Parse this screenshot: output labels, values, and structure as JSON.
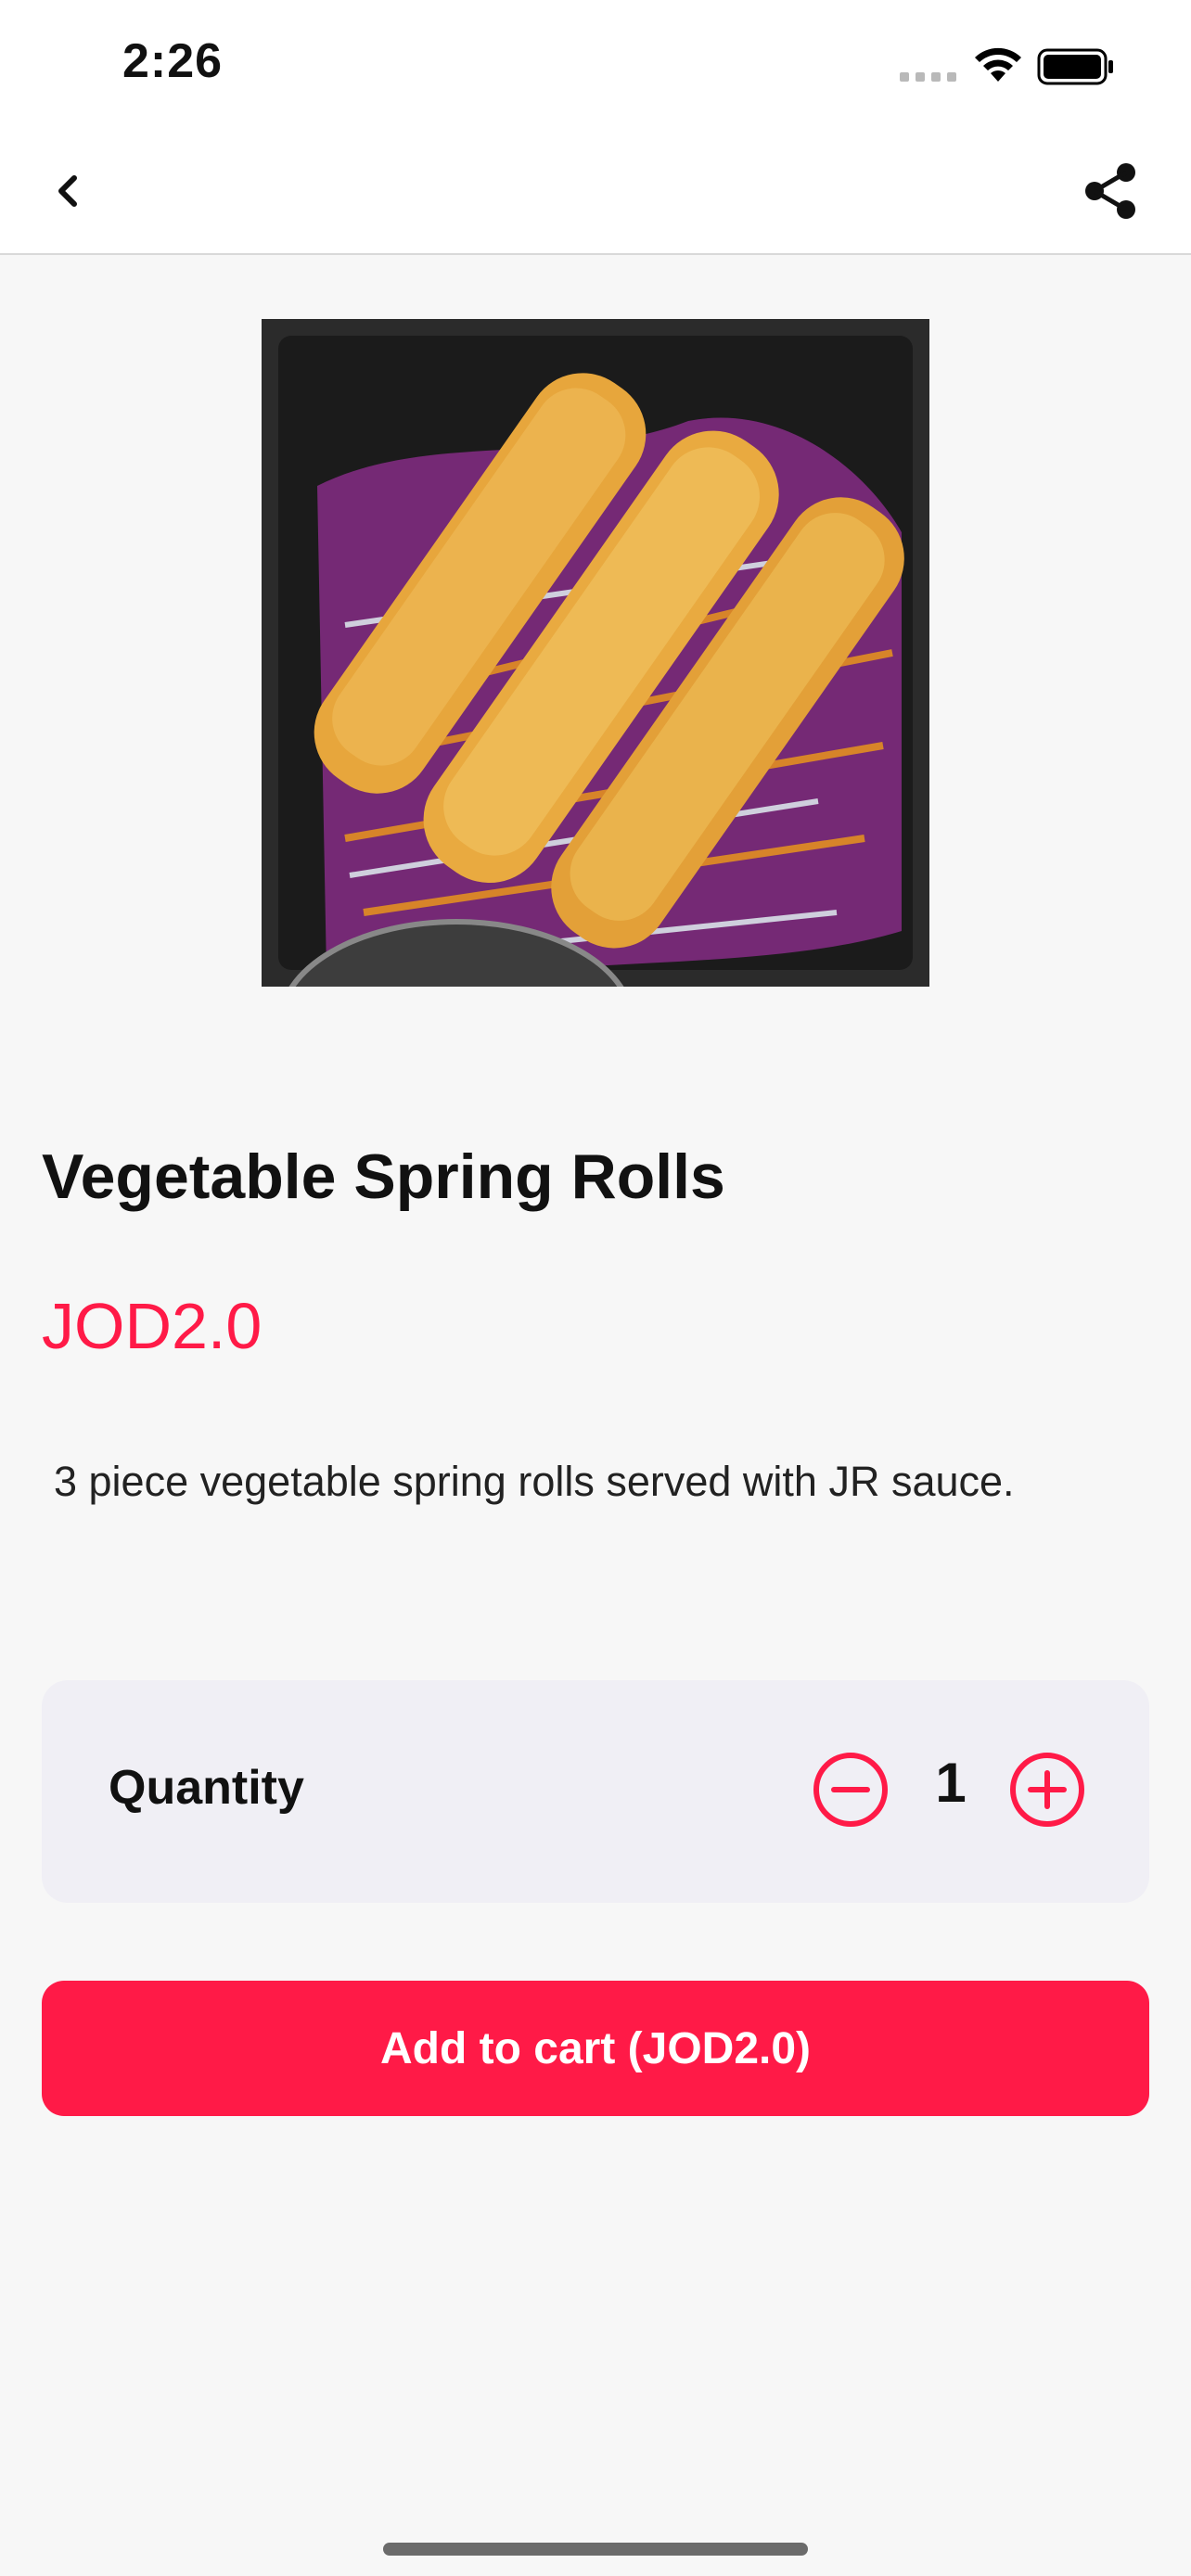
{
  "status_bar": {
    "time": "2:26"
  },
  "nav": {
    "back_icon": "chevron-left-icon",
    "share_icon": "share-icon"
  },
  "product": {
    "title": "Vegetable Spring Rolls",
    "price": "JOD2.0",
    "description": "3 piece vegetable spring rolls served with JR sauce.",
    "image_description": "Photo of three fried vegetable spring rolls on shredded red cabbage and carrots"
  },
  "quantity": {
    "label": "Quantity",
    "value": "1",
    "decrease_icon": "minus-circle-icon",
    "increase_icon": "plus-circle-icon"
  },
  "actions": {
    "add_to_cart_label": "Add to cart (JOD2.0)"
  },
  "colors": {
    "accent": "#ff1a47",
    "background": "#f7f7f7",
    "card": "#f0eff5"
  }
}
